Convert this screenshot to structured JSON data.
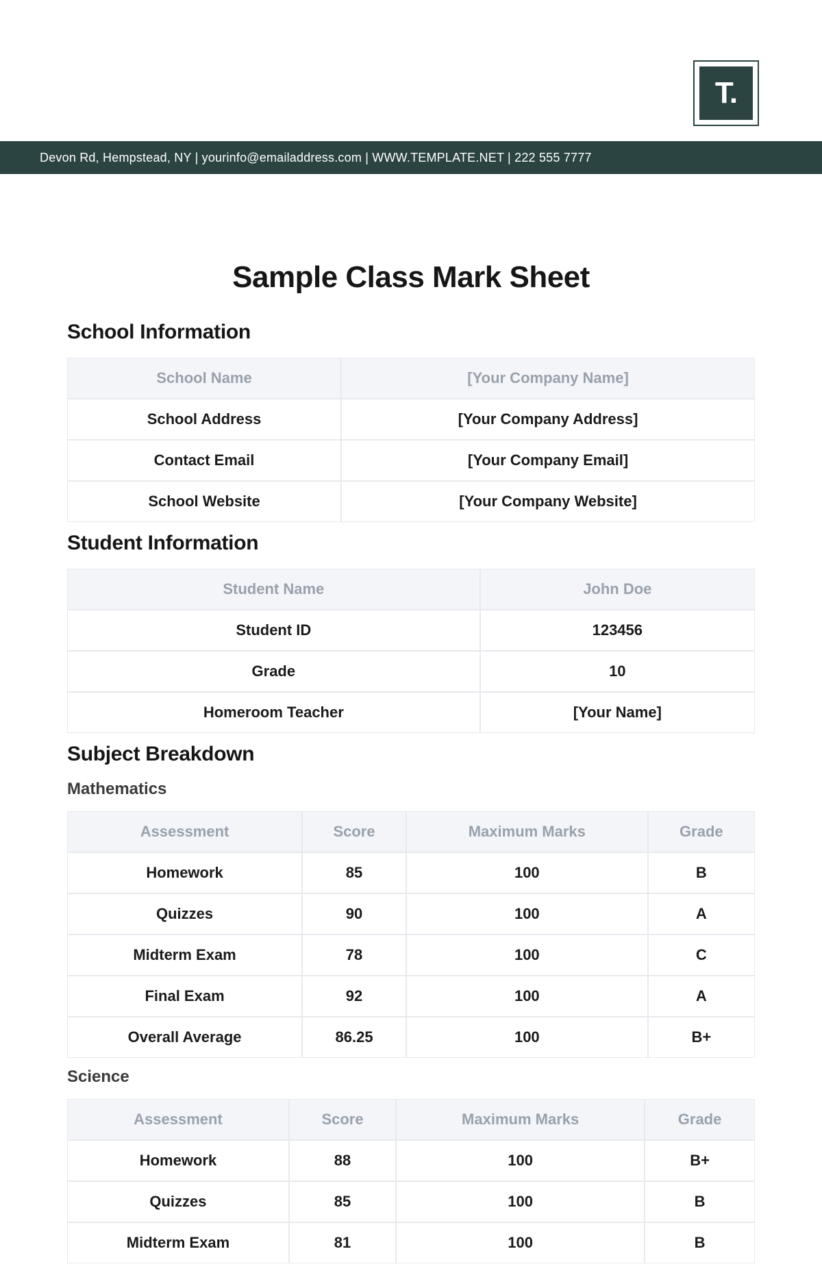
{
  "header": {
    "contact_line": "Devon Rd, Hempstead, NY | yourinfo@emailaddress.com | WWW.TEMPLATE.NET | 222 555 7777",
    "logo_text": "T."
  },
  "title": "Sample Class Mark Sheet",
  "sections": {
    "school_info_heading": "School Information",
    "student_info_heading": "Student Information",
    "subject_breakdown_heading": "Subject Breakdown"
  },
  "school_info": {
    "rows": [
      {
        "label": "School Name",
        "value": "[Your Company Name]"
      },
      {
        "label": "School Address",
        "value": "[Your Company Address]"
      },
      {
        "label": "Contact Email",
        "value": "[Your Company Email]"
      },
      {
        "label": "School Website",
        "value": "[Your Company Website]"
      }
    ]
  },
  "student_info": {
    "rows": [
      {
        "label": "Student Name",
        "value": "John Doe"
      },
      {
        "label": "Student ID",
        "value": "123456"
      },
      {
        "label": "Grade",
        "value": "10"
      },
      {
        "label": "Homeroom Teacher",
        "value": "[Your Name]"
      }
    ]
  },
  "grades_headers": {
    "assessment": "Assessment",
    "score": "Score",
    "max": "Maximum Marks",
    "grade": "Grade"
  },
  "subjects": [
    {
      "name": "Mathematics",
      "rows": [
        {
          "assessment": "Homework",
          "score": "85",
          "max": "100",
          "grade": "B"
        },
        {
          "assessment": "Quizzes",
          "score": "90",
          "max": "100",
          "grade": "A"
        },
        {
          "assessment": "Midterm Exam",
          "score": "78",
          "max": "100",
          "grade": "C"
        },
        {
          "assessment": "Final Exam",
          "score": "92",
          "max": "100",
          "grade": "A"
        },
        {
          "assessment": "Overall Average",
          "score": "86.25",
          "max": "100",
          "grade": "B+"
        }
      ]
    },
    {
      "name": "Science",
      "rows": [
        {
          "assessment": "Homework",
          "score": "88",
          "max": "100",
          "grade": "B+"
        },
        {
          "assessment": "Quizzes",
          "score": "85",
          "max": "100",
          "grade": "B"
        },
        {
          "assessment": "Midterm Exam",
          "score": "81",
          "max": "100",
          "grade": "B"
        }
      ]
    }
  ]
}
